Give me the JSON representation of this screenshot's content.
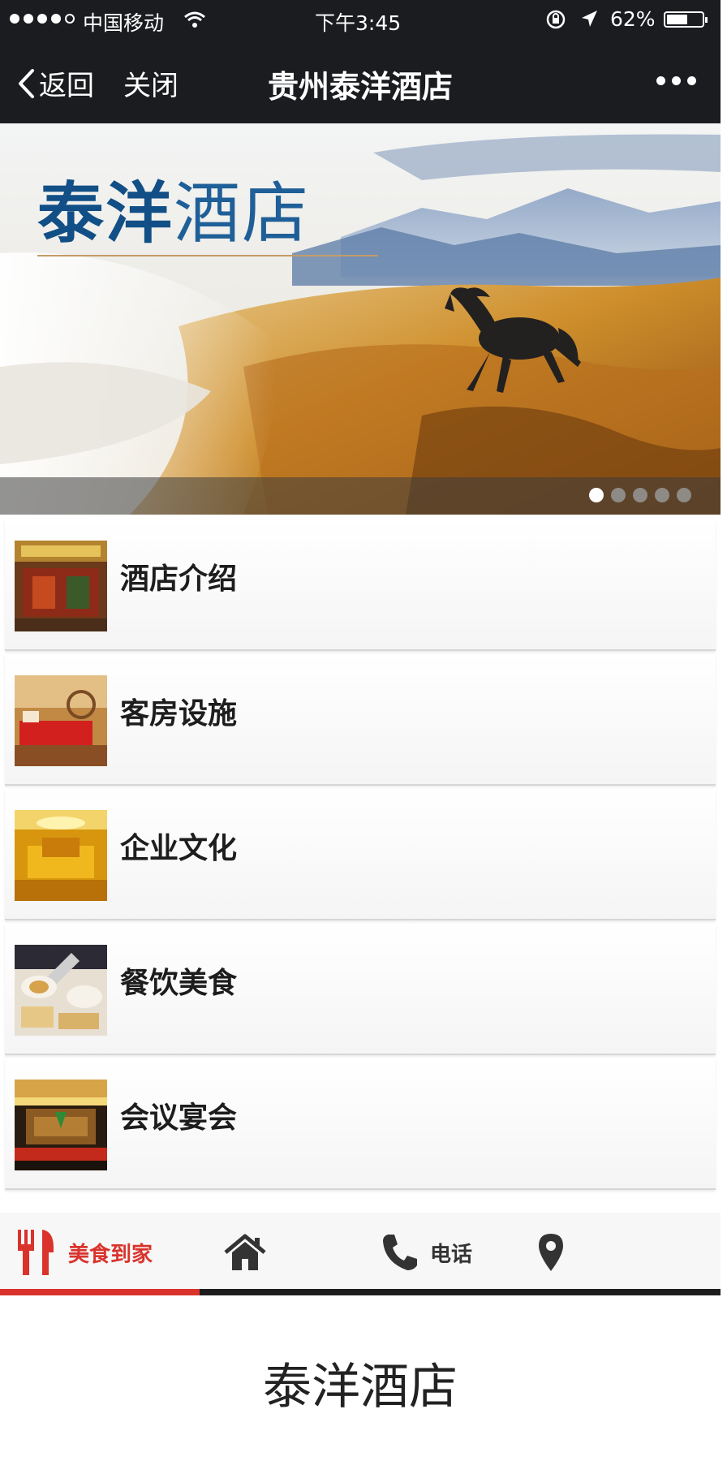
{
  "status_bar": {
    "carrier": "中国移动",
    "time": "下午3:45",
    "battery": "62%",
    "battery_level": 0.62
  },
  "nav": {
    "back_label": "返回",
    "close_label": "关闭",
    "title": "贵州泰洋酒店"
  },
  "banner": {
    "title_part1": "泰洋",
    "title_part2": "酒店",
    "slide_count": 5,
    "active_slide": 1
  },
  "menu": {
    "items": [
      {
        "title": "酒店介绍",
        "thumb": "hotel-exterior-photo"
      },
      {
        "title": "客房设施",
        "thumb": "guest-room-photo"
      },
      {
        "title": "企业文化",
        "thumb": "banquet-hall-photo"
      },
      {
        "title": "餐饮美食",
        "thumb": "food-dishes-photo"
      },
      {
        "title": "会议宴会",
        "thumb": "conference-hall-photo"
      }
    ]
  },
  "tabbar": {
    "tabs": [
      {
        "label": "美食到家",
        "icon": "fork-knife-icon",
        "active": true
      },
      {
        "label": "",
        "icon": "home-icon",
        "active": false
      },
      {
        "label": "电话",
        "icon": "phone-icon",
        "active": false
      },
      {
        "label": "",
        "icon": "map-pin-icon",
        "active": false
      }
    ]
  },
  "footer": {
    "title": "泰洋酒店"
  },
  "colors": {
    "header_bg": "#1b1c20",
    "accent_red": "#d9332c",
    "banner_blue": "#114f86"
  }
}
